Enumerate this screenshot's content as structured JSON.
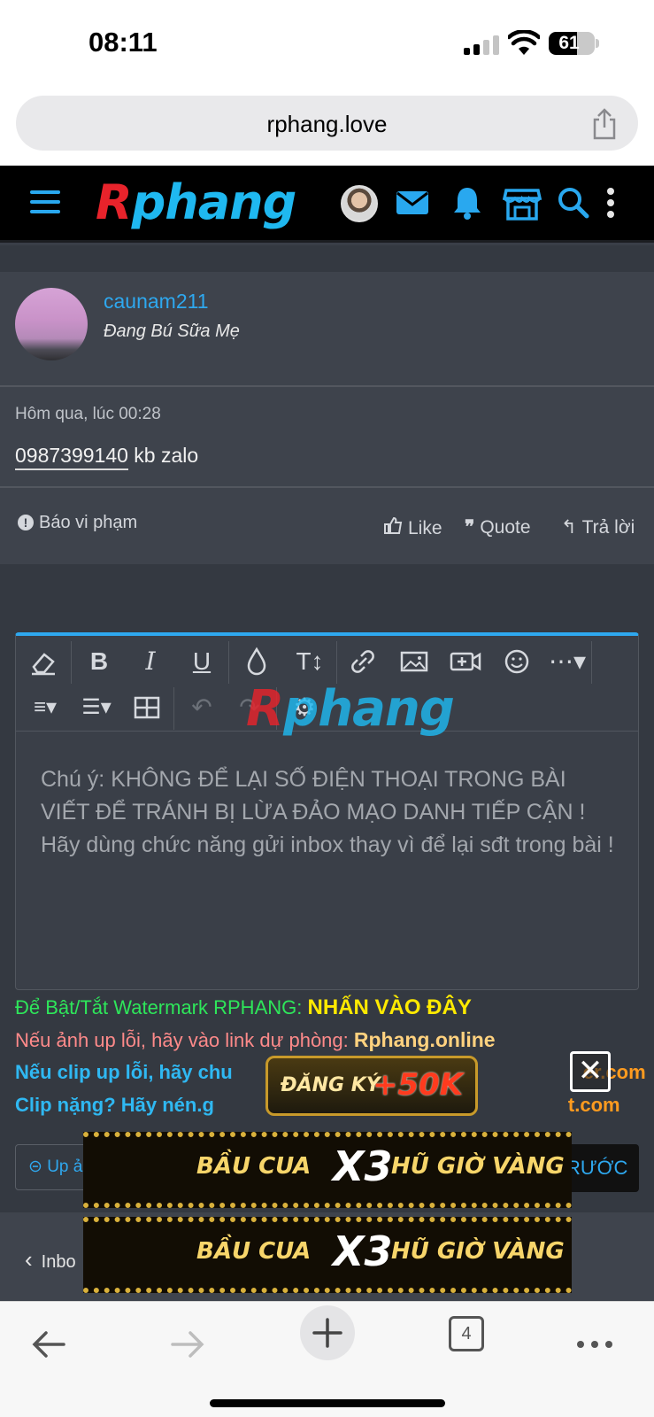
{
  "status_bar": {
    "time": "08:11",
    "battery": "61",
    "battery_level": 0.61
  },
  "browser": {
    "url": "rphang.love",
    "tab_count": "4"
  },
  "app_header": {
    "logo_r": "R",
    "logo_rest": "phang"
  },
  "post": {
    "username": "caunam211",
    "user_title": "Đang Bú Sữa Mẹ",
    "time": "Hôm qua, lúc 00:28",
    "phone": "0987399140",
    "body_rest": " kb zalo",
    "report_label": "Báo vi phạm",
    "like_label": "Like",
    "quote_label": "Quote",
    "reply_label": "Trả lời"
  },
  "editor": {
    "placeholder": "Chú ý: KHÔNG ĐỂ LẠI SỐ ĐIỆN THOẠI TRONG BÀI VIẾT ĐỂ TRÁNH BỊ LỪA ĐẢO MẠO DANH TIẾP CẬN ! Hãy dùng chức năng gửi inbox thay vì để lại sđt trong bài !"
  },
  "notices": {
    "watermark_text": "Để Bật/Tắt Watermark RPHANG: ",
    "watermark_link": "NHẤN VÀO ĐÂY",
    "backup_text": "Nếu ảnh up lỗi, hãy vào link dự phòng: ",
    "backup_link": "Rphang.online",
    "clip_text": "Nếu clip up lỗi, hãy chu",
    "clip_link": "er.com",
    "compress_text": "Clip nặng? Hãy nén.g",
    "compress_link": "t.com"
  },
  "buttons": {
    "upload_label": "Up ảnh/video lên",
    "submit_label": "RƯỚC",
    "inbox_label": "Inbo"
  },
  "ads": {
    "register_text": "ĐĂNG KÝ",
    "register_amount": "+50K",
    "close": "✕",
    "banner_left": "BẦU CUA",
    "banner_mid": "X3",
    "banner_right": "HŨ GIỜ VÀNG"
  },
  "colors": {
    "accent": "#2ea8ef",
    "header_bg": "#000000",
    "content_bg": "#3e434c"
  }
}
